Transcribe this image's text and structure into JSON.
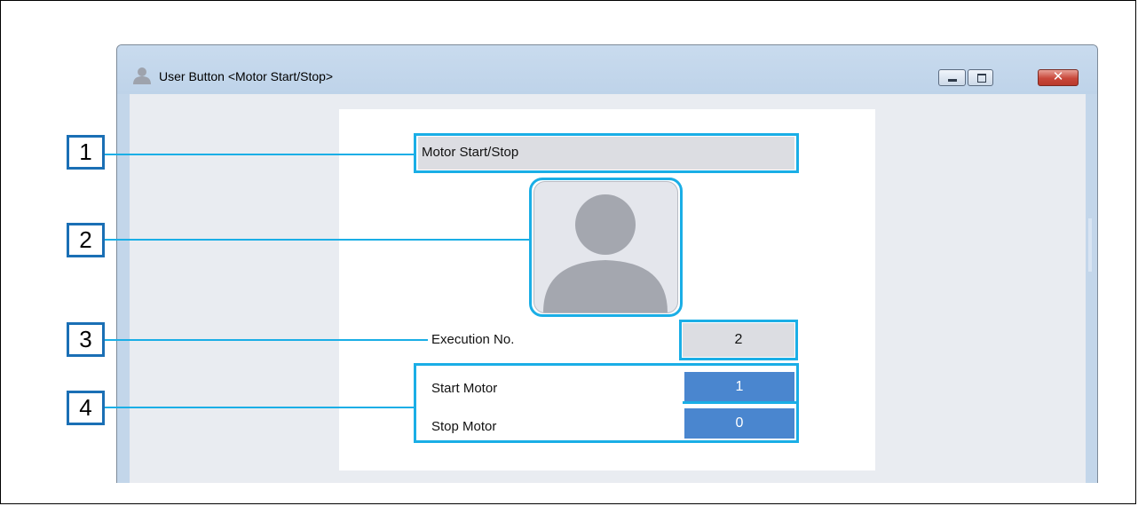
{
  "window": {
    "title": "User Button <Motor Start/Stop>",
    "controls": {
      "minimize_icon": "minimize-icon",
      "maximize_icon": "maximize-icon",
      "close_icon": "close-icon",
      "close_glyph": "✕"
    }
  },
  "panel": {
    "button_title": "Motor Start/Stop",
    "image_icon": "person-placeholder-icon",
    "execution": {
      "label": "Execution No.",
      "value": "2"
    },
    "bits": [
      {
        "label": "Start Motor",
        "value": "1"
      },
      {
        "label": "Stop Motor",
        "value": "0"
      }
    ]
  },
  "callouts": [
    "1",
    "2",
    "3",
    "4"
  ],
  "colors": {
    "highlight": "#1aaee6",
    "callout_border": "#1a6fb5",
    "bit_value_bg": "#4a86cf",
    "field_bg": "#dcdde2"
  }
}
